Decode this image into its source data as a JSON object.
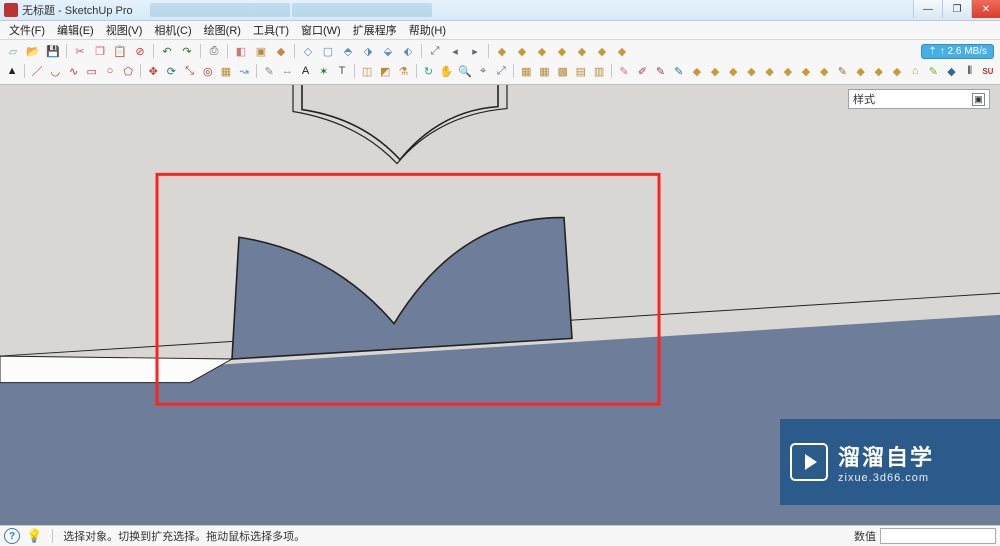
{
  "title": "无标题 - SketchUp Pro",
  "menus": [
    "文件(F)",
    "编辑(E)",
    "视图(V)",
    "相机(C)",
    "绘图(R)",
    "工具(T)",
    "窗口(W)",
    "扩展程序",
    "帮助(H)"
  ],
  "net_badge": "↑ 2.6 MB/s",
  "styles_panel": {
    "label": "样式"
  },
  "status": {
    "help": "?",
    "tip": "选择对象。切换到扩充选择。拖动鼠标选择多项。",
    "vcb_label": "数值",
    "vcb_value": ""
  },
  "watermark": {
    "name": "溜溜自学",
    "url": "zixue.3d66.com"
  },
  "win": {
    "min": "—",
    "max": "❐",
    "close": "✕"
  },
  "toolbar_rows": [
    [
      {
        "n": "new-icon",
        "c": "#6aa",
        "g": "▱"
      },
      {
        "n": "open-icon",
        "c": "#caa24a",
        "g": "📂"
      },
      {
        "n": "save-icon",
        "c": "#3b6ac0",
        "g": "💾"
      },
      {
        "sep": true
      },
      {
        "n": "cut-icon",
        "c": "#d55",
        "g": "✂"
      },
      {
        "n": "copy-icon",
        "c": "#d55",
        "g": "❐"
      },
      {
        "n": "paste-icon",
        "c": "#d55",
        "g": "📋"
      },
      {
        "n": "delete-icon",
        "c": "#d33",
        "g": "⊘"
      },
      {
        "sep": true
      },
      {
        "n": "undo-icon",
        "c": "#2a7e2a",
        "g": "↶"
      },
      {
        "n": "redo-icon",
        "c": "#2a7e2a",
        "g": "↷"
      },
      {
        "sep": true
      },
      {
        "n": "print-icon",
        "c": "#555",
        "g": "⎙"
      },
      {
        "sep": true
      },
      {
        "n": "materials-icon",
        "c": "#c77",
        "g": "◧"
      },
      {
        "n": "components-icon",
        "c": "#b98b3a",
        "g": "▣"
      },
      {
        "n": "paint-icon",
        "c": "#c8883a",
        "g": "◆"
      },
      {
        "sep": true
      },
      {
        "n": "iso-icon",
        "c": "#5a8bc4",
        "g": "◇"
      },
      {
        "n": "top-icon",
        "c": "#5a8bc4",
        "g": "▢"
      },
      {
        "n": "front-icon",
        "c": "#5a8bc4",
        "g": "⬘"
      },
      {
        "n": "right-icon",
        "c": "#5a8bc4",
        "g": "⬗"
      },
      {
        "n": "back-icon",
        "c": "#5a8bc4",
        "g": "⬙"
      },
      {
        "n": "left-icon",
        "c": "#5a8bc4",
        "g": "⬖"
      },
      {
        "sep": true
      },
      {
        "n": "zoom-extents-icon",
        "c": "#667",
        "g": "⤢"
      },
      {
        "n": "prev-view-icon",
        "c": "#667",
        "g": "◂"
      },
      {
        "n": "next-view-icon",
        "c": "#667",
        "g": "▸"
      },
      {
        "sep": true
      },
      {
        "n": "plugin-1-icon",
        "c": "#c89b3a",
        "g": "◆"
      },
      {
        "n": "plugin-2-icon",
        "c": "#c89b3a",
        "g": "◆"
      },
      {
        "n": "plugin-3-icon",
        "c": "#c89b3a",
        "g": "◆"
      },
      {
        "n": "plugin-4-icon",
        "c": "#c89b3a",
        "g": "◆"
      },
      {
        "n": "plugin-5-icon",
        "c": "#c89b3a",
        "g": "◆"
      },
      {
        "n": "plugin-6-icon",
        "c": "#c89b3a",
        "g": "◆"
      },
      {
        "n": "plugin-7-icon",
        "c": "#c89b3a",
        "g": "◆"
      }
    ],
    [
      {
        "n": "select-icon",
        "c": "#222",
        "g": "▲"
      },
      {
        "sep": true
      },
      {
        "n": "line-icon",
        "c": "#b33",
        "g": "／"
      },
      {
        "n": "arc-icon",
        "c": "#b33",
        "g": "◡"
      },
      {
        "n": "freehand-icon",
        "c": "#b33",
        "g": "∿"
      },
      {
        "n": "rect-icon",
        "c": "#b33",
        "g": "▭"
      },
      {
        "n": "circle-icon",
        "c": "#b33",
        "g": "○"
      },
      {
        "n": "poly-icon",
        "c": "#b33",
        "g": "⬠"
      },
      {
        "sep": true
      },
      {
        "n": "move-icon",
        "c": "#b33",
        "g": "✥"
      },
      {
        "n": "rotate-icon",
        "c": "#278",
        "g": "⟳"
      },
      {
        "n": "scale-icon",
        "c": "#b33",
        "g": "⤡"
      },
      {
        "n": "offset-icon",
        "c": "#b33",
        "g": "◎"
      },
      {
        "n": "pushpull-icon",
        "c": "#b98b3a",
        "g": "▦"
      },
      {
        "n": "followme-icon",
        "c": "#5a8bc4",
        "g": "↝"
      },
      {
        "sep": true
      },
      {
        "n": "tape-icon",
        "c": "#888",
        "g": "✎"
      },
      {
        "n": "dimension-icon",
        "c": "#888",
        "g": "↔"
      },
      {
        "n": "text-icon",
        "c": "#222",
        "g": "A"
      },
      {
        "n": "axes-icon",
        "c": "#2a7e2a",
        "g": "✶"
      },
      {
        "n": "3dtext-icon",
        "c": "#555",
        "g": "T"
      },
      {
        "sep": true
      },
      {
        "n": "section-icon",
        "c": "#c8883a",
        "g": "◫"
      },
      {
        "n": "material-icon",
        "c": "#c8883a",
        "g": "◩"
      },
      {
        "n": "paintbucket-icon",
        "c": "#c8883a",
        "g": "⚗"
      },
      {
        "sep": true
      },
      {
        "n": "orbit-icon",
        "c": "#2a8",
        "g": "↻"
      },
      {
        "n": "pan-icon",
        "c": "#c89b3a",
        "g": "✋"
      },
      {
        "n": "zoom-icon",
        "c": "#667",
        "g": "🔍"
      },
      {
        "n": "zoom-window-icon",
        "c": "#667",
        "g": "⌖"
      },
      {
        "n": "zoom-extents2-icon",
        "c": "#667",
        "g": "⤢"
      },
      {
        "sep": true
      },
      {
        "n": "sandbox-1-icon",
        "c": "#b98b3a",
        "g": "▦"
      },
      {
        "n": "sandbox-2-icon",
        "c": "#b98b3a",
        "g": "▦"
      },
      {
        "n": "sandbox-3-icon",
        "c": "#b98b3a",
        "g": "▩"
      },
      {
        "n": "sandbox-4-icon",
        "c": "#b98b3a",
        "g": "▤"
      },
      {
        "n": "sandbox-5-icon",
        "c": "#b98b3a",
        "g": "▥"
      },
      {
        "sep": true
      },
      {
        "n": "ext-1-icon",
        "c": "#c77",
        "g": "✎"
      },
      {
        "n": "ext-2-icon",
        "c": "#944",
        "g": "✐"
      },
      {
        "n": "ext-3-icon",
        "c": "#944",
        "g": "✎"
      },
      {
        "n": "ext-4-icon",
        "c": "#279",
        "g": "✎"
      },
      {
        "n": "ext-5-icon",
        "c": "#c89b3a",
        "g": "◆"
      },
      {
        "n": "ext-6-icon",
        "c": "#c89b3a",
        "g": "◆"
      },
      {
        "n": "ext-7-icon",
        "c": "#c89b3a",
        "g": "◆"
      },
      {
        "n": "ext-8-icon",
        "c": "#c89b3a",
        "g": "◆"
      },
      {
        "n": "ext-9-icon",
        "c": "#c89b3a",
        "g": "◆"
      },
      {
        "n": "ext-10-icon",
        "c": "#c89b3a",
        "g": "◆"
      },
      {
        "n": "ext-11-icon",
        "c": "#c89b3a",
        "g": "◆"
      },
      {
        "n": "ext-12-icon",
        "c": "#c89b3a",
        "g": "◆"
      },
      {
        "n": "ext-13-icon",
        "c": "#964",
        "g": "✎"
      },
      {
        "n": "ext-14-icon",
        "c": "#c89b3a",
        "g": "◆"
      },
      {
        "n": "ext-15-icon",
        "c": "#c89b3a",
        "g": "◆"
      },
      {
        "n": "ext-16-icon",
        "c": "#c89b3a",
        "g": "◆"
      },
      {
        "n": "ext-17-icon",
        "c": "#c89b3a",
        "g": "⌂"
      },
      {
        "n": "ext-18-icon",
        "c": "#7a3",
        "g": "✎"
      },
      {
        "n": "ext-19-icon",
        "c": "#369",
        "g": "◆"
      },
      {
        "n": "ext-barcode-icon",
        "c": "#222",
        "g": "⫴"
      },
      {
        "n": "ext-su-icon",
        "c": "#b33",
        "g": "SU"
      }
    ]
  ]
}
